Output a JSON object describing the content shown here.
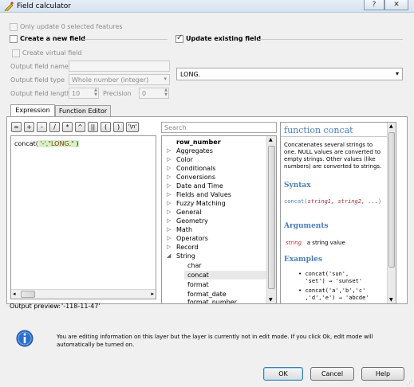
{
  "window": {
    "title": "Field calculator",
    "help_glyph": "?",
    "close_glyph": "✕"
  },
  "options": {
    "only_update_selected": "Only update 0 selected features",
    "create_new_field": "Create a new field",
    "update_existing_field": "Update existing field",
    "create_virtual_field": "Create virtual field",
    "output_field_name_label": "Output field name",
    "output_field_type_label": "Output field type",
    "output_field_type_value": "Whole number (integer)",
    "output_field_length_label": "Output field length",
    "output_field_length_value": "10",
    "precision_label": "Precision",
    "precision_value": "0",
    "existing_field_value": "LONG."
  },
  "tabs": [
    {
      "label": "Expression"
    },
    {
      "label": "Function Editor"
    }
  ],
  "operators": [
    "=",
    "+",
    "-",
    "/",
    "*",
    "^",
    "||",
    "(",
    ")",
    "'\\n'"
  ],
  "expression": {
    "prefix": "concat(",
    "args": " '-',\"LONG.\" ",
    "suffix": ")"
  },
  "search": {
    "placeholder": "Search"
  },
  "function_tree": {
    "top_item": "row_number",
    "groups": [
      "Aggregates",
      "Color",
      "Conditionals",
      "Conversions",
      "Date and Time",
      "Fields and Values",
      "Fuzzy Matching",
      "General",
      "Geometry",
      "Math",
      "Operators",
      "Record",
      "String"
    ],
    "string_items": [
      "char",
      "concat",
      "format",
      "format_date",
      "format_number"
    ]
  },
  "help": {
    "title": "function concat",
    "description": "Concatenates several strings to one. NULL values are converted to empty strings. Other values (like numbers) are converted to strings.",
    "syntax_heading": "Syntax",
    "syntax_fn": "concat(",
    "syntax_args": "string1, string2, ...",
    "syntax_end": ")",
    "arguments_heading": "Arguments",
    "arg_name": "string",
    "arg_desc": "a string value",
    "examples_heading": "Examples",
    "example1_a": "concat('sun',",
    "example1_b": "'set') → 'sunset'",
    "example2_a": "concat('a','b','c'",
    "example2_b": ",'d','e') → 'abcde'"
  },
  "preview": {
    "label": "Output preview:",
    "value": "'-118-11-47'"
  },
  "info": {
    "message_line1": "You are editing information on this layer but the layer is currently not in edit mode. If you click Ok, edit mode will",
    "message_line2": "automatically be turned on."
  },
  "buttons": {
    "ok": "OK",
    "cancel": "Cancel",
    "help": "Help"
  },
  "colors": {
    "accent": "#4a7ebb",
    "info_icon": "#2a6fc9",
    "selection": "#e8e8e8"
  }
}
